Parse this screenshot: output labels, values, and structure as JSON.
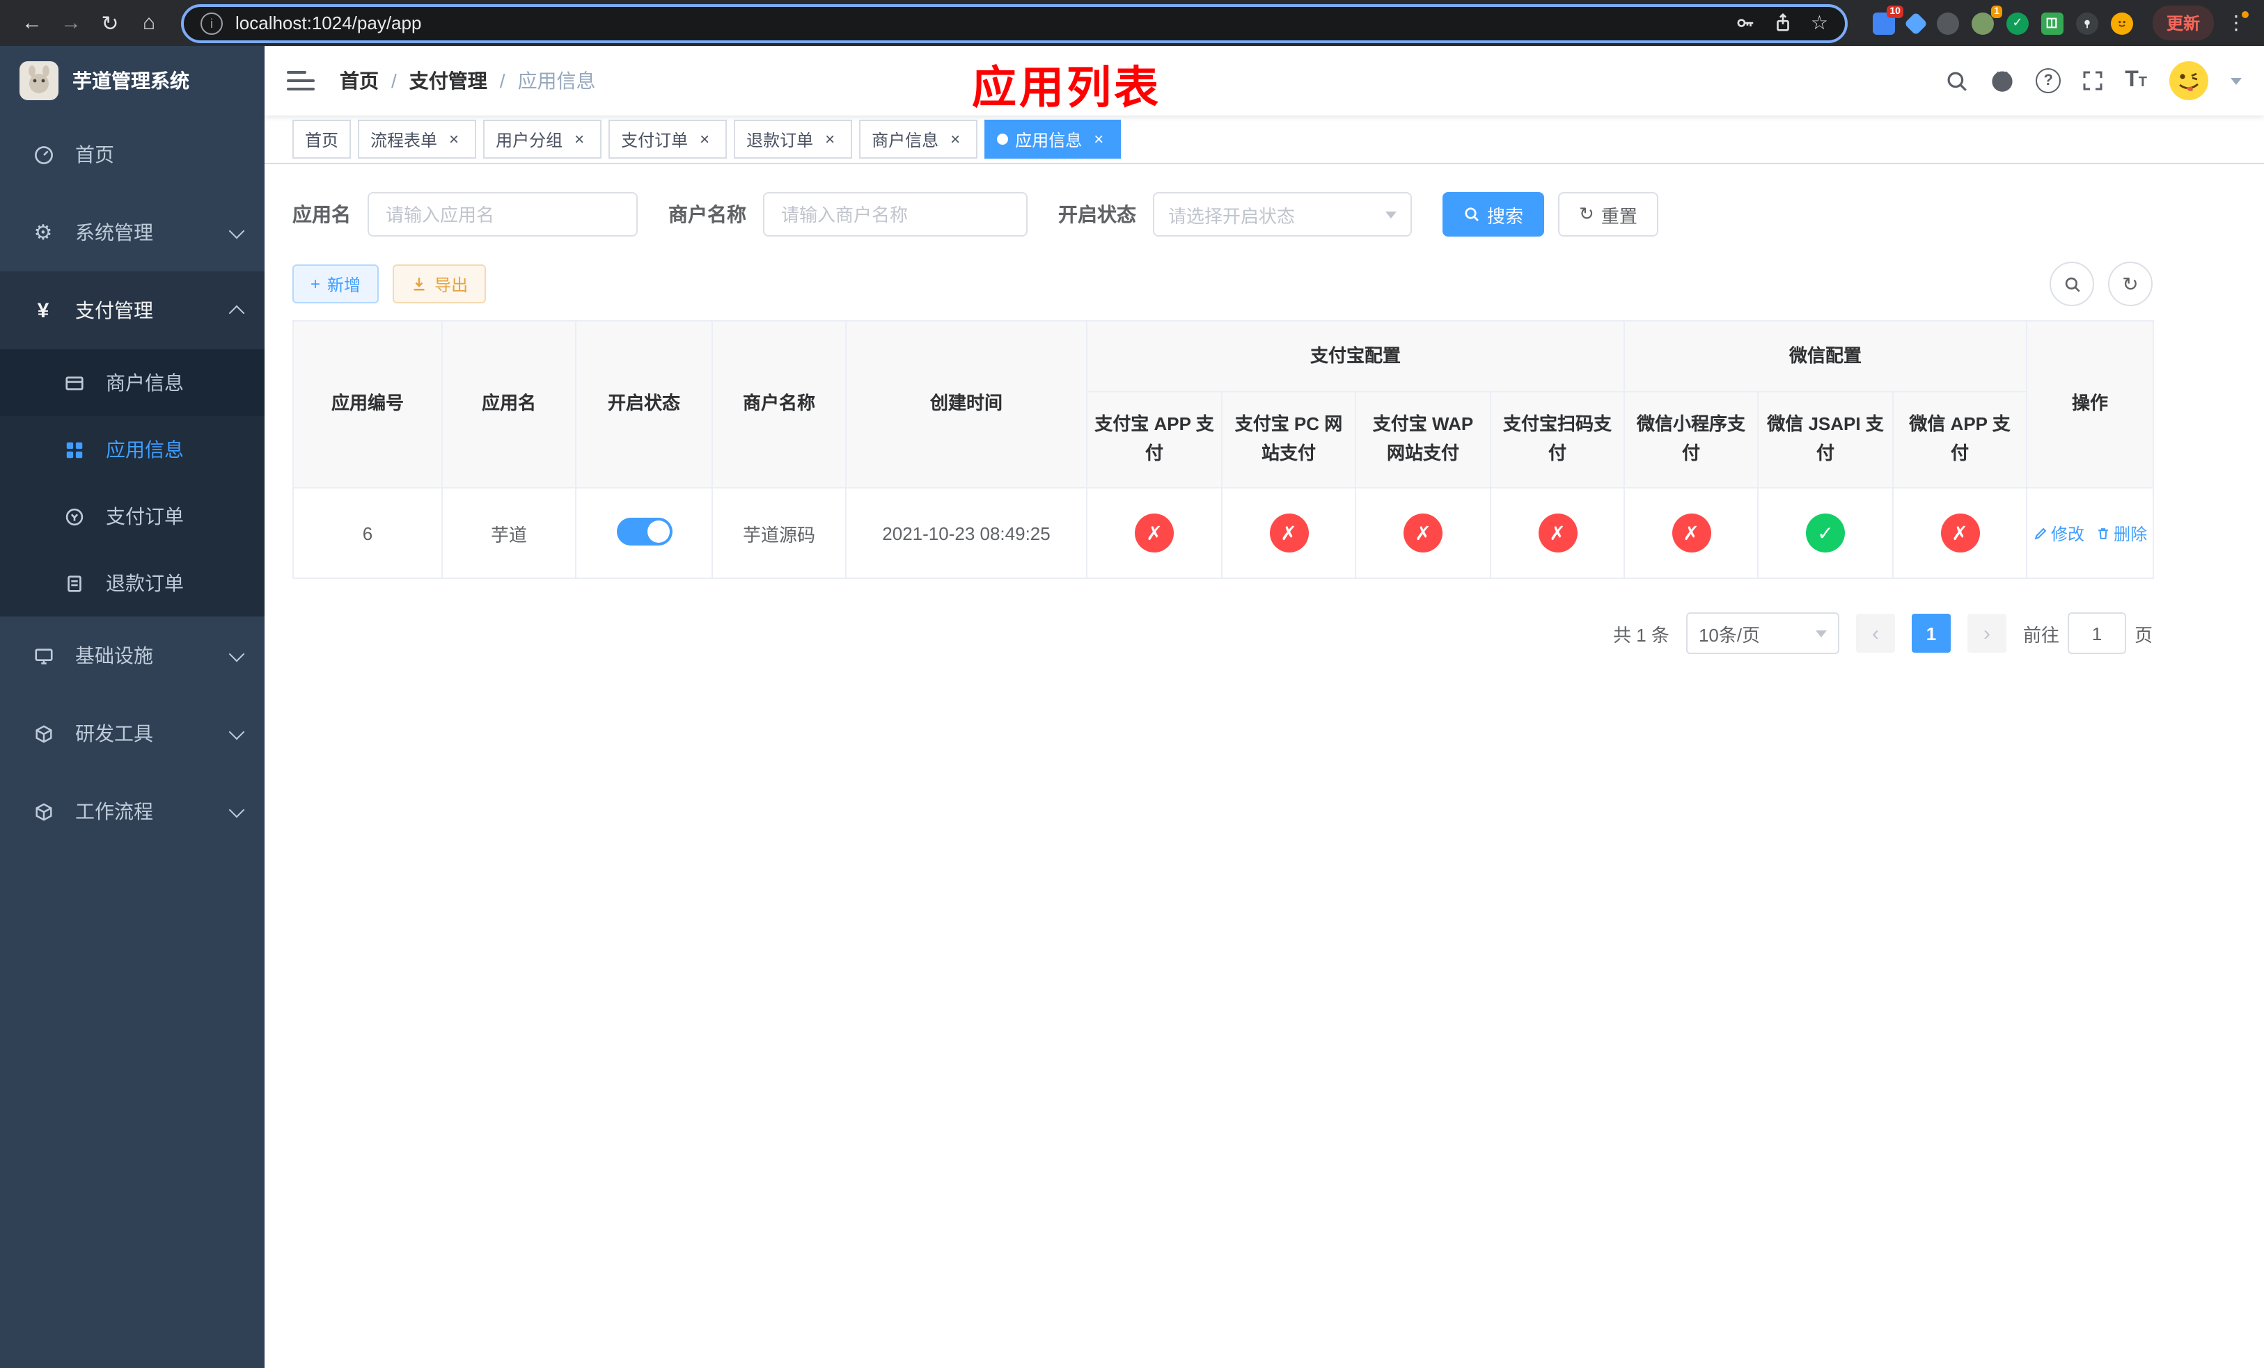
{
  "browser": {
    "url": "localhost:1024/pay/app",
    "update_label": "更新",
    "ext_badge_grid": "10",
    "ext_badge_avatar": "1"
  },
  "glyphs": {
    "back": "←",
    "forward": "→",
    "reload": "↻",
    "home": "⌂",
    "info": "i",
    "star": "☆",
    "kebab": "⋮",
    "close": "×",
    "question": "?",
    "letter_t_big": "T",
    "letter_t_small": "T",
    "gear": "⚙",
    "yen": "¥",
    "refresh": "↻",
    "plus": "+",
    "prev": "‹",
    "next": "›"
  },
  "sidebar": {
    "title": "芋道管理系统",
    "items": [
      {
        "label": "首页"
      },
      {
        "label": "系统管理"
      },
      {
        "label": "支付管理"
      },
      {
        "label": "基础设施"
      },
      {
        "label": "研发工具"
      },
      {
        "label": "工作流程"
      }
    ],
    "children": [
      {
        "label": "商户信息"
      },
      {
        "label": "应用信息"
      },
      {
        "label": "支付订单"
      },
      {
        "label": "退款订单"
      }
    ]
  },
  "navbar": {
    "breadcrumb": [
      "首页",
      "支付管理",
      "应用信息"
    ],
    "separator": "/",
    "overlay_title": "应用列表"
  },
  "tabs": [
    {
      "label": "首页"
    },
    {
      "label": "流程表单"
    },
    {
      "label": "用户分组"
    },
    {
      "label": "支付订单"
    },
    {
      "label": "退款订单"
    },
    {
      "label": "商户信息"
    },
    {
      "label": "应用信息"
    }
  ],
  "filter": {
    "app_name_label": "应用名",
    "app_name_placeholder": "请输入应用名",
    "merchant_label": "商户名称",
    "merchant_placeholder": "请输入商户名称",
    "status_label": "开启状态",
    "status_placeholder": "请选择开启状态",
    "search": "搜索",
    "reset": "重置"
  },
  "toolbar": {
    "add": "新增",
    "export": "导出"
  },
  "table": {
    "headers": {
      "app_id": "应用编号",
      "app_name": "应用名",
      "status": "开启状态",
      "merchant": "商户名称",
      "created": "创建时间",
      "alipay_group": "支付宝配置",
      "wechat_group": "微信配置",
      "actions": "操作",
      "alipay_app": "支付宝 APP 支付",
      "alipay_pc": "支付宝 PC 网站支付",
      "alipay_wap": "支付宝 WAP 网站支付",
      "alipay_qr": "支付宝扫码支付",
      "wx_mini": "微信小程序支付",
      "wx_jsapi": "微信 JSAPI 支付",
      "wx_app": "微信 APP 支付"
    },
    "row": {
      "id": "6",
      "name": "芋道",
      "status_on": true,
      "merchant": "芋道源码",
      "created": "2021-10-23 08:49:25",
      "status_cells": [
        {
          "cls": "st no",
          "glyph": "✗"
        },
        {
          "cls": "st no",
          "glyph": "✗"
        },
        {
          "cls": "st no",
          "glyph": "✗"
        },
        {
          "cls": "st no",
          "glyph": "✗"
        },
        {
          "cls": "st no",
          "glyph": "✗"
        },
        {
          "cls": "st yes",
          "glyph": "✓"
        },
        {
          "cls": "st no",
          "glyph": "✗"
        }
      ],
      "edit": "修改",
      "delete": "删除"
    }
  },
  "pagination": {
    "total": "共 1 条",
    "page_size": "10条/页",
    "page": "1",
    "goto_prefix": "前往",
    "goto_value": "1",
    "goto_suffix": "页"
  },
  "colors": {
    "primary": "#409eff",
    "success": "#13ce66",
    "danger": "#ff4949",
    "warning": "#e6a23c",
    "annotation_red": "#ff0000",
    "sidebar_bg": "#304156",
    "submenu_bg": "#1f2d3d"
  }
}
